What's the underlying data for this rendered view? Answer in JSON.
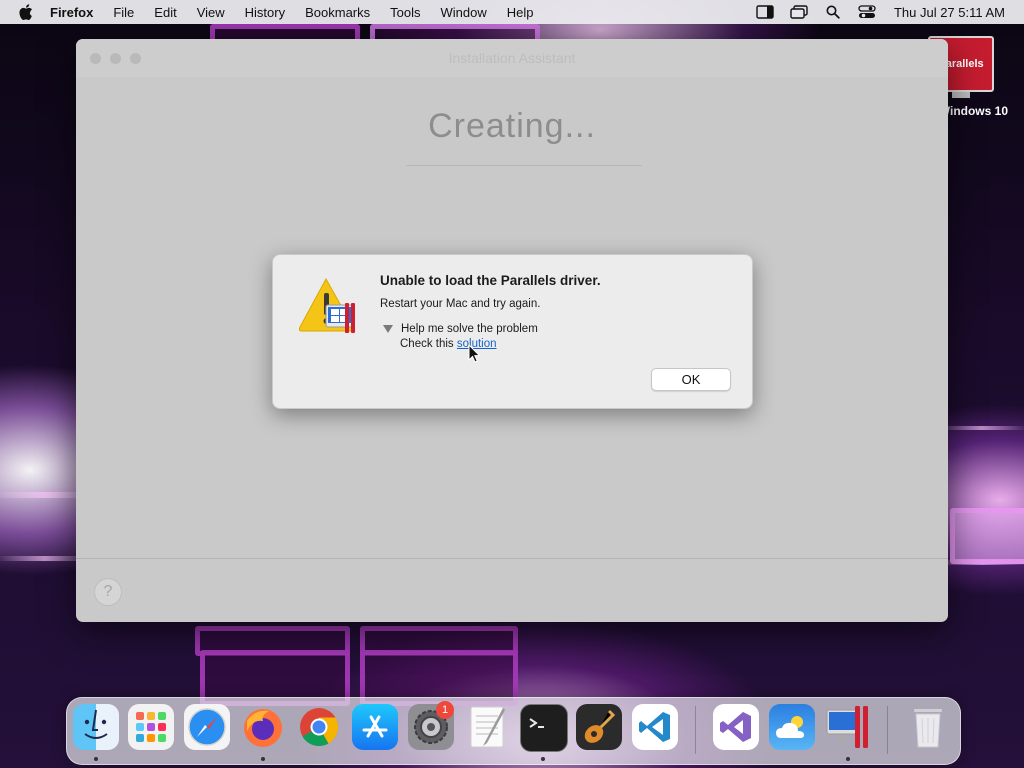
{
  "menubar": {
    "app": "Firefox",
    "items": [
      "File",
      "Edit",
      "View",
      "History",
      "Bookmarks",
      "Tools",
      "Window",
      "Help"
    ],
    "clock": "Thu Jul 27  5:11 AM",
    "status_icons": [
      "sidebar-icon",
      "window-icon",
      "search-icon",
      "control-center-icon"
    ]
  },
  "desktop": {
    "icon_label": "Windows 10",
    "icon_logo_text": "Parallels"
  },
  "window": {
    "title": "Installation Assistant",
    "heading": "Creating...",
    "help_label": "?"
  },
  "alert": {
    "title": "Unable to load the Parallels driver.",
    "message": "Restart your Mac and try again.",
    "disclosure": "Help me solve the problem",
    "check_prefix": "Check this ",
    "check_link": "solution",
    "ok_label": "OK"
  },
  "dock": {
    "apps": [
      "Finder",
      "Launchpad",
      "Safari",
      "Firefox",
      "Google Chrome",
      "App Store",
      "System Preferences",
      "TextEdit",
      "Terminal",
      "GarageBand",
      "Visual Studio Code",
      "Visual Studio",
      "Weather",
      "Parallels Desktop",
      "Trash"
    ],
    "settings_badge": "1"
  },
  "colors": {
    "link": "#1764c8",
    "badge": "#f0473b",
    "parallels_red": "#c51c30"
  }
}
